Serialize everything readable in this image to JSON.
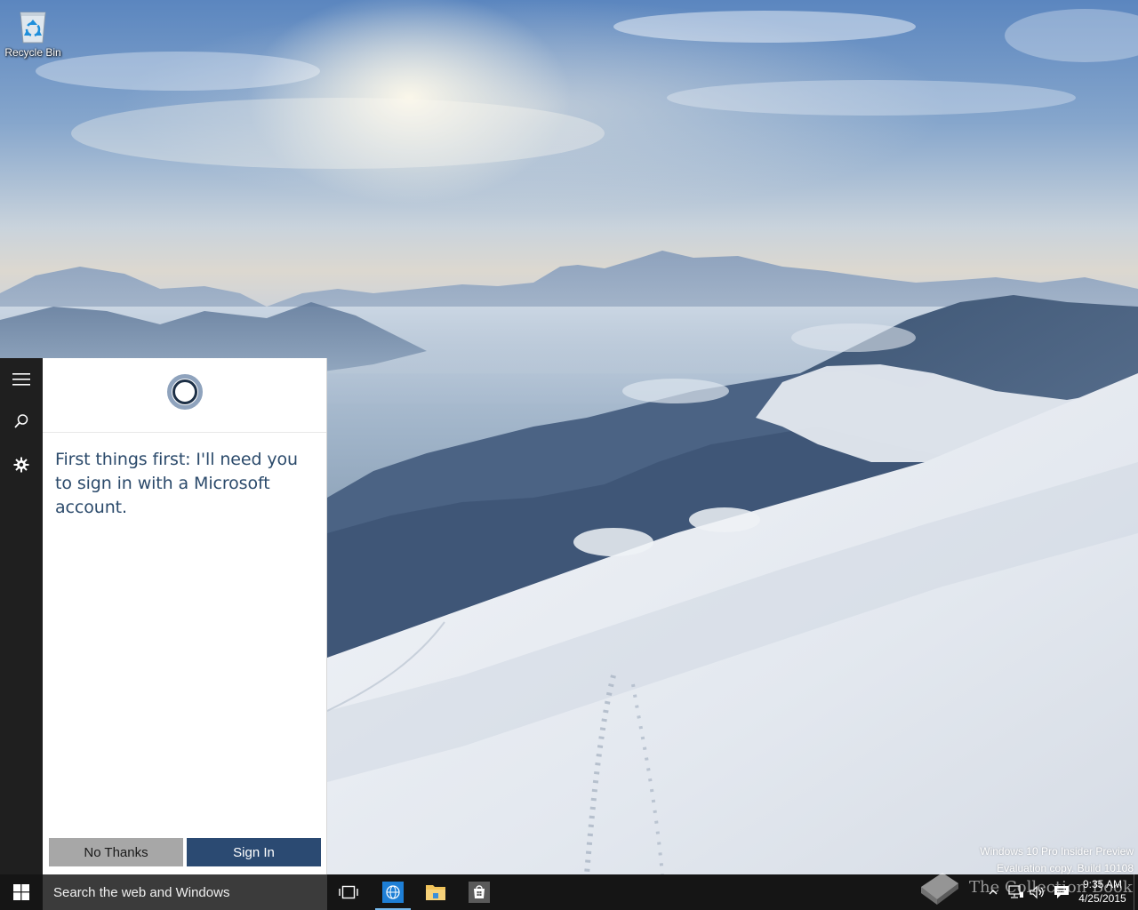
{
  "desktop": {
    "icons": [
      {
        "label": "Recycle Bin",
        "icon": "recycle-bin-icon"
      }
    ],
    "wallpaper": "snowy-mountain-landscape"
  },
  "cortana": {
    "rail": {
      "menu_icon": "hamburger-menu-icon",
      "search_icon": "search-icon",
      "settings_icon": "gear-icon"
    },
    "logo_icon": "cortana-ring-icon",
    "message": "First things first: I'll need you to sign in with a Microsoft account.",
    "buttons": {
      "no_thanks": "No Thanks",
      "sign_in": "Sign In"
    },
    "colors": {
      "rail_bg": "#1f1f1f",
      "text": "#2b4a6b",
      "sign_in_bg": "#2b4a72",
      "no_thanks_bg": "#a7a7a7"
    }
  },
  "watermark": {
    "line1": "Windows 10 Pro Insider Preview",
    "line2": "Evaluation copy. Build 10108"
  },
  "taskbar": {
    "start_icon": "windows-logo-icon",
    "search_placeholder": "Search the web and Windows",
    "apps": [
      {
        "name": "Task View",
        "icon": "task-view-icon"
      },
      {
        "name": "Browser",
        "icon": "globe-icon",
        "active": true
      },
      {
        "name": "File Explorer",
        "icon": "folder-icon"
      },
      {
        "name": "Store",
        "icon": "store-bag-icon"
      }
    ],
    "tray": {
      "chevron_icon": "chevron-up-icon",
      "network_icon": "network-icon",
      "volume_icon": "volume-icon",
      "action_center_icon": "action-center-icon"
    },
    "clock": {
      "time": "9:35 AM",
      "date": "4/25/2015"
    },
    "accent": "#76b9ed"
  },
  "overlay": {
    "site_name": "The Collection Book"
  }
}
